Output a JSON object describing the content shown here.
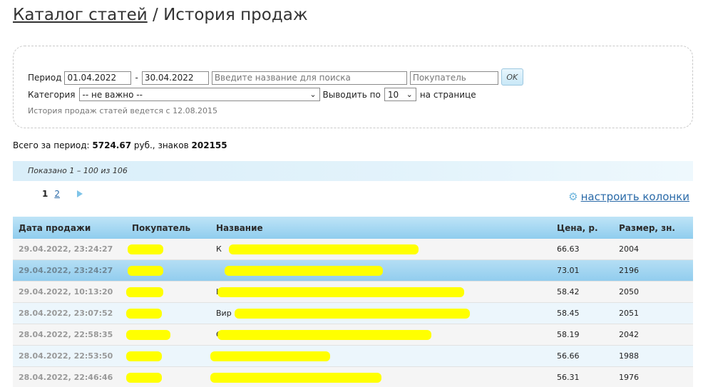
{
  "header": {
    "catalog_link": "Каталог статей",
    "separator": "/",
    "current": "История продаж"
  },
  "filter": {
    "period_label": "Период",
    "date_from": "01.04.2022",
    "date_dash": "-",
    "date_to": "30.04.2022",
    "search_placeholder": "Введите название для поиска",
    "buyer_placeholder": "Покупатель",
    "ok_label": "OK",
    "category_label": "Категория",
    "category_value": "-- не важно --",
    "per_page_label": "Выводить по",
    "per_page_value": "10",
    "per_page_suffix": "на странице",
    "history_note": "История продаж статей ведется с 12.08.2015"
  },
  "summary": {
    "label": "Всего за период:",
    "amount": "5724.67",
    "currency": "руб., знаков",
    "chars": "202155"
  },
  "shown": "Показано 1 – 100 из 106",
  "pager": {
    "current": "1",
    "page2": "2"
  },
  "configure_columns": "настроить колонки",
  "table": {
    "columns": [
      "Дата продажи",
      "Покупатель",
      "Название",
      "Цена, р.",
      "Размер, зн."
    ],
    "rows": [
      {
        "date": "29.04.2022, 23:24:27",
        "buyer": "",
        "title": "К",
        "price": "66.63",
        "size": "2004"
      },
      {
        "date": "29.04.2022, 23:24:27",
        "buyer": "",
        "title": "",
        "price": "73.01",
        "size": "2196"
      },
      {
        "date": "29.04.2022, 10:13:20",
        "buyer": "",
        "title": "К",
        "price": "58.42",
        "size": "2050"
      },
      {
        "date": "28.04.2022, 23:07:52",
        "buyer": "",
        "title": "Вир",
        "price": "58.45",
        "size": "2051"
      },
      {
        "date": "28.04.2022, 22:58:35",
        "buyer": "",
        "title": "С",
        "price": "58.19",
        "size": "2042"
      },
      {
        "date": "28.04.2022, 22:53:50",
        "buyer": "",
        "title": "",
        "price": "56.66",
        "size": "1988"
      },
      {
        "date": "28.04.2022, 22:46:46",
        "buyer": "",
        "title": "",
        "price": "56.31",
        "size": "1976"
      }
    ]
  },
  "colors": {
    "header_gradient_top": "#bfe4f7",
    "header_gradient_bottom": "#8fcdee",
    "link": "#2a6aa8",
    "redaction": "#ffff00"
  }
}
